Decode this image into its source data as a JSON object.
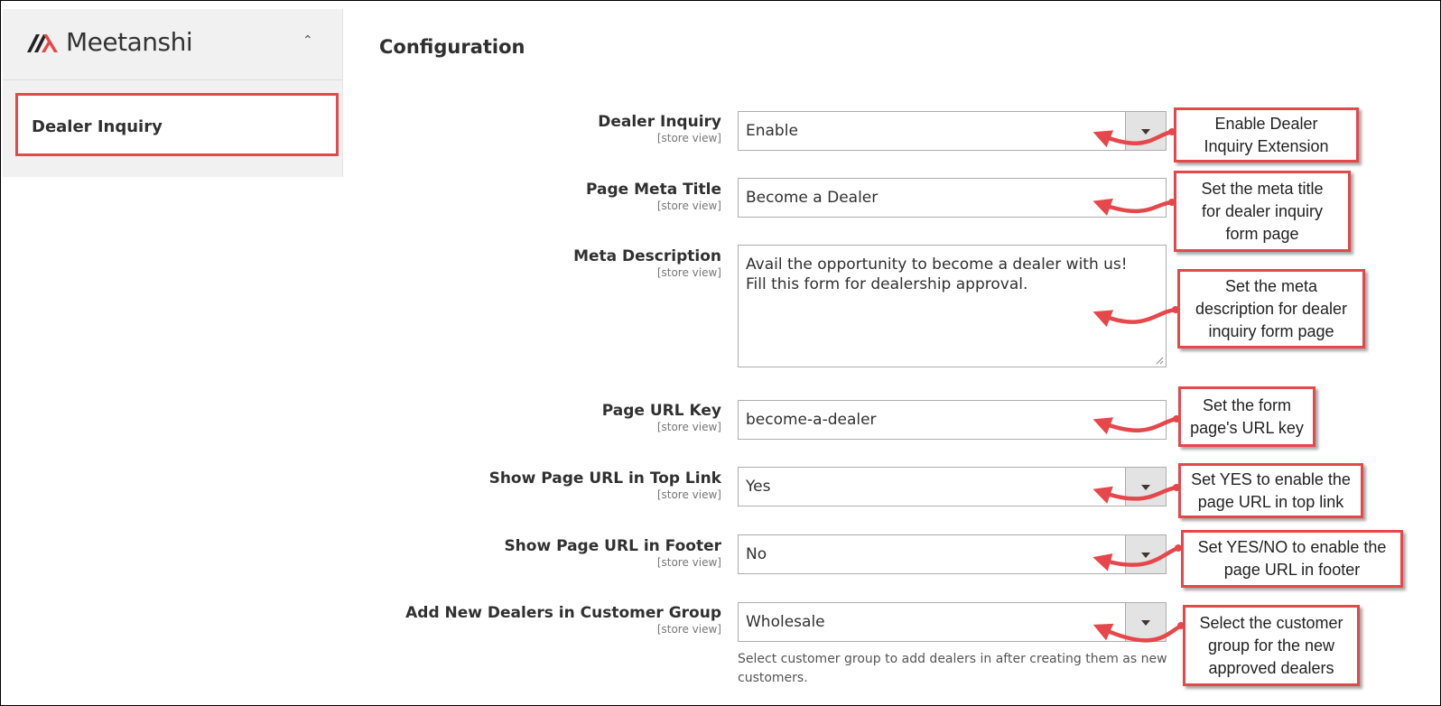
{
  "brand": {
    "name": "Meetanshi",
    "accent": "#e5474b"
  },
  "sidebar": {
    "items": [
      {
        "label": "Dealer Inquiry"
      }
    ]
  },
  "page": {
    "title": "Configuration"
  },
  "fields": [
    {
      "label": "Dealer Inquiry",
      "scope": "[store view]",
      "value": "Enable"
    },
    {
      "label": "Page Meta Title",
      "scope": "[store view]",
      "value": "Become a Dealer"
    },
    {
      "label": "Meta Description",
      "scope": "[store view]",
      "lines": [
        "Avail the opportunity to become a dealer with us!",
        "Fill this form for dealership approval."
      ]
    },
    {
      "label": "Page URL Key",
      "scope": "[store view]",
      "value": "become-a-dealer"
    },
    {
      "label": "Show Page URL in Top Link",
      "scope": "[store view]",
      "value": "Yes"
    },
    {
      "label": "Show Page URL in Footer",
      "scope": "[store view]",
      "value": "No"
    },
    {
      "label": "Add New Dealers in Customer Group",
      "scope": "[store view]",
      "value": "Wholesale",
      "note": "Select customer group to add dealers in after creating them as new customers."
    }
  ],
  "callouts": [
    [
      "Enable Dealer",
      "Inquiry Extension"
    ],
    [
      "Set the meta title",
      "for dealer inquiry",
      "form page"
    ],
    [
      "Set the meta",
      "description for dealer",
      "inquiry form page"
    ],
    [
      "Set the form",
      "page's URL key"
    ],
    [
      "Set YES to enable the",
      "page URL in top link"
    ],
    [
      "Set YES/NO to enable the",
      "page URL in footer"
    ],
    [
      "Select the customer",
      "group for the new",
      "approved dealers"
    ]
  ]
}
